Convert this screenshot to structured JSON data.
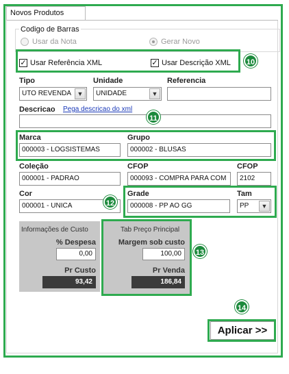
{
  "tab": {
    "label": "Novos Produtos"
  },
  "barcode": {
    "legend": "Codigo de Barras",
    "option_use_note": "Usar da Nota",
    "option_generate_new": "Gerar Novo"
  },
  "xml_options": {
    "use_reference": "Usar Referência XML",
    "use_description": "Usar Descrição XML"
  },
  "fields": {
    "tipo": {
      "label": "Tipo",
      "value": "UTO REVENDA"
    },
    "unidade": {
      "label": "Unidade",
      "value": "UNIDADE"
    },
    "referencia": {
      "label": "Referencia",
      "value": ""
    },
    "descricao": {
      "label": "Descricao",
      "link": "Pega descricao do xml",
      "value": ""
    },
    "marca": {
      "label": "Marca",
      "value": "000003 - LOGSISTEMAS"
    },
    "grupo": {
      "label": "Grupo",
      "value": "000002 - BLUSAS"
    },
    "colecao": {
      "label": "Coleção",
      "value": "000001 - PADRAO"
    },
    "cfop1": {
      "label": "CFOP",
      "value": "000093 - COMPRA PARA COM"
    },
    "cfop2": {
      "label": "CFOP",
      "value": "2102"
    },
    "cor": {
      "label": "Cor",
      "value": "000001 - UNICA"
    },
    "grade": {
      "label": "Grade",
      "value": "000008 - PP AO GG"
    },
    "tam": {
      "label": "Tam",
      "value": "PP"
    }
  },
  "cost": {
    "title": "Informações de Custo",
    "expense_label": "% Despesa",
    "expense_value": "0,00",
    "cost_label": "Pr Custo",
    "cost_value": "93,42"
  },
  "price_table": {
    "title": "Tab Preço Principal",
    "margin_label": "Margem sob custo",
    "margin_value": "100,00",
    "sale_label": "Pr Venda",
    "sale_value": "186,84"
  },
  "apply_button": "Aplicar >>",
  "badges": {
    "b10": "10",
    "b11": "11",
    "b12": "12",
    "b13": "13",
    "b14": "14"
  },
  "colors": {
    "highlight": "#2eaa4f",
    "badge": "#1c8a3c",
    "panel": "#c7c7c7",
    "dark_value": "#3b3b3b"
  }
}
